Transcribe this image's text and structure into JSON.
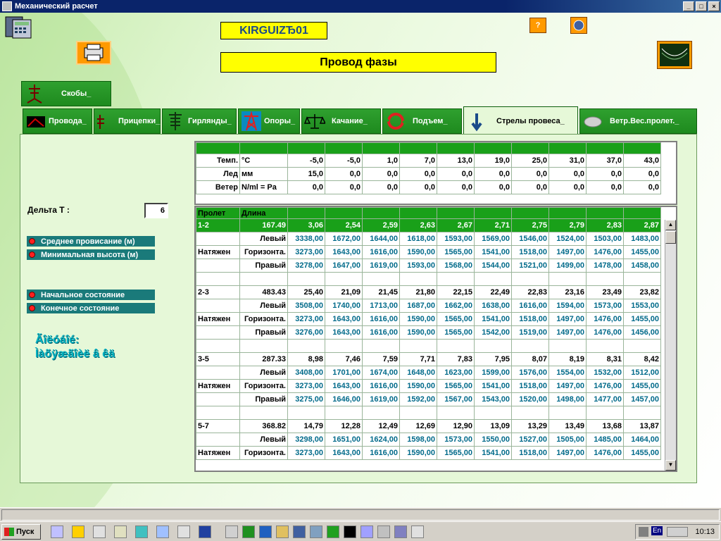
{
  "window": {
    "title": "Механический расчет"
  },
  "header": {
    "project": "KIRGUIZЂ01",
    "subtitle": "Провод фазы"
  },
  "top_tab": {
    "label": "Скобы_"
  },
  "tabs": [
    {
      "label": "Провода_",
      "icon": "wire-icon"
    },
    {
      "label": "Прицепки_",
      "icon": "clamp-icon"
    },
    {
      "label": "Гирлянды_",
      "icon": "insulator-icon"
    },
    {
      "label": "Опоры_",
      "icon": "tower-icon"
    },
    {
      "label": "Качание_",
      "icon": "scales-icon"
    },
    {
      "label": "Подъем_",
      "icon": "lift-icon"
    },
    {
      "label": "Стрелы провеса_",
      "icon": "arrow-down-icon"
    },
    {
      "label": "Ветр.Вес.пролет._",
      "icon": "cloud-icon"
    }
  ],
  "conditions": {
    "rows": [
      {
        "name": "Темп.",
        "unit": "°C",
        "values": [
          "-5,0",
          "-5,0",
          "1,0",
          "7,0",
          "13,0",
          "19,0",
          "25,0",
          "31,0",
          "37,0",
          "43,0"
        ]
      },
      {
        "name": "Лед",
        "unit": "мм",
        "values": [
          "15,0",
          "0,0",
          "0,0",
          "0,0",
          "0,0",
          "0,0",
          "0,0",
          "0,0",
          "0,0",
          "0,0"
        ]
      },
      {
        "name": "Ветер",
        "unit": "N/ml = Pa",
        "values": [
          "0,0",
          "0,0",
          "0,0",
          "0,0",
          "0,0",
          "0,0",
          "0,0",
          "0,0",
          "0,0",
          "0,0"
        ]
      }
    ]
  },
  "delta": {
    "label": "Дельта Т :",
    "value": "6"
  },
  "options": [
    "Среднее провисание (м)",
    "Минимальная высота (м)",
    "Начальное состояние",
    "Конечное состояние"
  ],
  "garbled_text": [
    "Ãîëóáîé:",
    "Ìàõÿæãîèë â êä"
  ],
  "spans": {
    "headers": [
      "Пролет",
      "Длина"
    ],
    "rows": [
      {
        "a": "1-2",
        "b": "167.49",
        "vals": [
          "3,06",
          "2,54",
          "2,59",
          "2,63",
          "2,67",
          "2,71",
          "2,75",
          "2,79",
          "2,83",
          "2,87"
        ],
        "style": "span"
      },
      {
        "a": "",
        "b": "Левый",
        "vals": [
          "3338,00",
          "1672,00",
          "1644,00",
          "1618,00",
          "1593,00",
          "1569,00",
          "1546,00",
          "1524,00",
          "1503,00",
          "1483,00"
        ],
        "style": "blue"
      },
      {
        "a": "Натяжен",
        "b": "Горизонта.",
        "vals": [
          "3273,00",
          "1643,00",
          "1616,00",
          "1590,00",
          "1565,00",
          "1541,00",
          "1518,00",
          "1497,00",
          "1476,00",
          "1455,00"
        ],
        "style": "blue"
      },
      {
        "a": "",
        "b": "Правый",
        "vals": [
          "3278,00",
          "1647,00",
          "1619,00",
          "1593,00",
          "1568,00",
          "1544,00",
          "1521,00",
          "1499,00",
          "1478,00",
          "1458,00"
        ],
        "style": "blue"
      },
      {
        "a": "",
        "b": "",
        "vals": [
          "",
          "",
          "",
          "",
          "",
          "",
          "",
          "",
          "",
          ""
        ],
        "style": "blank"
      },
      {
        "a": "2-3",
        "b": "483.43",
        "vals": [
          "25,40",
          "21,09",
          "21,45",
          "21,80",
          "22,15",
          "22,49",
          "22,83",
          "23,16",
          "23,49",
          "23,82"
        ],
        "style": "plain"
      },
      {
        "a": "",
        "b": "Левый",
        "vals": [
          "3508,00",
          "1740,00",
          "1713,00",
          "1687,00",
          "1662,00",
          "1638,00",
          "1616,00",
          "1594,00",
          "1573,00",
          "1553,00"
        ],
        "style": "blue"
      },
      {
        "a": "Натяжен",
        "b": "Горизонта.",
        "vals": [
          "3273,00",
          "1643,00",
          "1616,00",
          "1590,00",
          "1565,00",
          "1541,00",
          "1518,00",
          "1497,00",
          "1476,00",
          "1455,00"
        ],
        "style": "blue"
      },
      {
        "a": "",
        "b": "Правый",
        "vals": [
          "3276,00",
          "1643,00",
          "1616,00",
          "1590,00",
          "1565,00",
          "1542,00",
          "1519,00",
          "1497,00",
          "1476,00",
          "1456,00"
        ],
        "style": "blue"
      },
      {
        "a": "",
        "b": "",
        "vals": [
          "",
          "",
          "",
          "",
          "",
          "",
          "",
          "",
          "",
          ""
        ],
        "style": "blank"
      },
      {
        "a": "3-5",
        "b": "287.33",
        "vals": [
          "8,98",
          "7,46",
          "7,59",
          "7,71",
          "7,83",
          "7,95",
          "8,07",
          "8,19",
          "8,31",
          "8,42"
        ],
        "style": "plain"
      },
      {
        "a": "",
        "b": "Левый",
        "vals": [
          "3408,00",
          "1701,00",
          "1674,00",
          "1648,00",
          "1623,00",
          "1599,00",
          "1576,00",
          "1554,00",
          "1532,00",
          "1512,00"
        ],
        "style": "blue"
      },
      {
        "a": "Натяжен",
        "b": "Горизонта.",
        "vals": [
          "3273,00",
          "1643,00",
          "1616,00",
          "1590,00",
          "1565,00",
          "1541,00",
          "1518,00",
          "1497,00",
          "1476,00",
          "1455,00"
        ],
        "style": "blue"
      },
      {
        "a": "",
        "b": "Правый",
        "vals": [
          "3275,00",
          "1646,00",
          "1619,00",
          "1592,00",
          "1567,00",
          "1543,00",
          "1520,00",
          "1498,00",
          "1477,00",
          "1457,00"
        ],
        "style": "blue"
      },
      {
        "a": "",
        "b": "",
        "vals": [
          "",
          "",
          "",
          "",
          "",
          "",
          "",
          "",
          "",
          ""
        ],
        "style": "blank"
      },
      {
        "a": "5-7",
        "b": "368.82",
        "vals": [
          "14,79",
          "12,28",
          "12,49",
          "12,69",
          "12,90",
          "13,09",
          "13,29",
          "13,49",
          "13,68",
          "13,87"
        ],
        "style": "plain"
      },
      {
        "a": "",
        "b": "Левый",
        "vals": [
          "3298,00",
          "1651,00",
          "1624,00",
          "1598,00",
          "1573,00",
          "1550,00",
          "1527,00",
          "1505,00",
          "1485,00",
          "1464,00"
        ],
        "style": "blue"
      },
      {
        "a": "Натяжен",
        "b": "Горизонта.",
        "vals": [
          "3273,00",
          "1643,00",
          "1616,00",
          "1590,00",
          "1565,00",
          "1541,00",
          "1518,00",
          "1497,00",
          "1476,00",
          "1455,00"
        ],
        "style": "blue"
      }
    ]
  },
  "taskbar": {
    "start_label": "Пуск",
    "lang": "En",
    "time": "10:13"
  }
}
